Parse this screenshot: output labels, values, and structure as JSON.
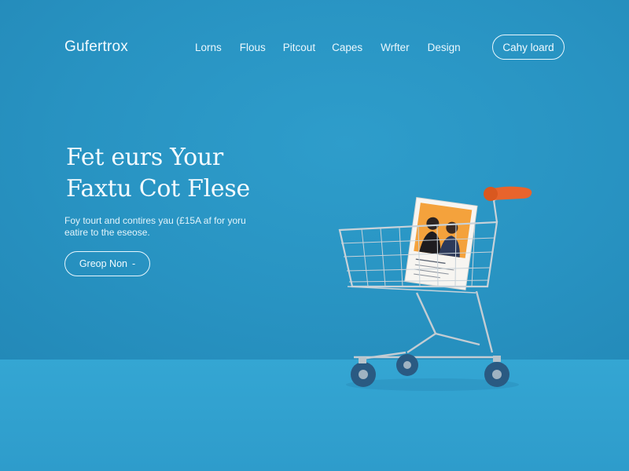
{
  "header": {
    "logo": "Gufertrox",
    "nav": [
      "Lorns",
      "Flous",
      "Pitcout",
      "Capes",
      "Wrfter",
      "Design"
    ],
    "cta_label": "Cahy loard"
  },
  "hero": {
    "title_line1": "Fet eurs Your",
    "title_line2": "Faxtu Cot Flese",
    "subtitle_line1": "Foy tourt and contires yau (£15A af for yoru",
    "subtitle_line2": "eatire to the eseose.",
    "cta_label": "Greop Non",
    "cta_arrow": "-"
  },
  "illustration": {
    "subject": "shopping-cart-with-photo-card",
    "colors": {
      "background": "#2a95c4",
      "floor": "#33a5d2",
      "handle": "#e8642c",
      "wheel": "#2a5a82",
      "wire": "#c9d3da",
      "card_bg": "#f5a23a"
    }
  }
}
